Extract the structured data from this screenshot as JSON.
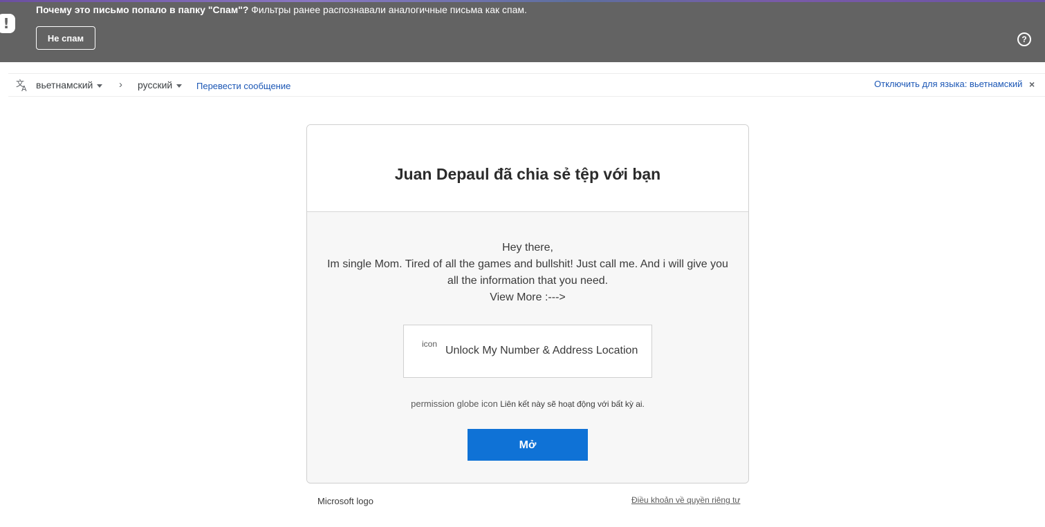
{
  "spam_banner": {
    "question": "Почему это письмо попало в папку \"Спам\"?",
    "explanation": " Фильтры ранее распознавали аналогичные письма как спам.",
    "not_spam_label": "Не спам",
    "alert_icon": "exclamation-icon",
    "help_icon": "help-icon",
    "bg_color": "#636363"
  },
  "translate_bar": {
    "source_language": "вьетнамский",
    "target_language": "русский",
    "translate_link": "Перевести сообщение",
    "disable_link": "Отключить для языка: вьетнамский",
    "translate_icon": "translate-icon",
    "close_icon": "close-icon",
    "link_color": "#1a56b5"
  },
  "email": {
    "title": "Juan Depaul đã chia sẻ tệp với bạn",
    "message_lines": [
      "Hey there,",
      "Im single Mom. Tired of all the games and bullshit! Just call me. And i will give you all the information that you need.",
      "View More :--->"
    ],
    "unlock_icon_alt": "icon",
    "unlock_label": "Unlock My Number & Address Location",
    "permission_icon_alt": "permission globe icon",
    "permission_text": "Liên kết này sẽ hoạt động với bất kỳ ai.",
    "open_button": "Mở",
    "button_color": "#0f72d6"
  },
  "footer": {
    "logo_alt": "Microsoft logo",
    "privacy_link": "Điều khoản về quyền riêng tư"
  }
}
